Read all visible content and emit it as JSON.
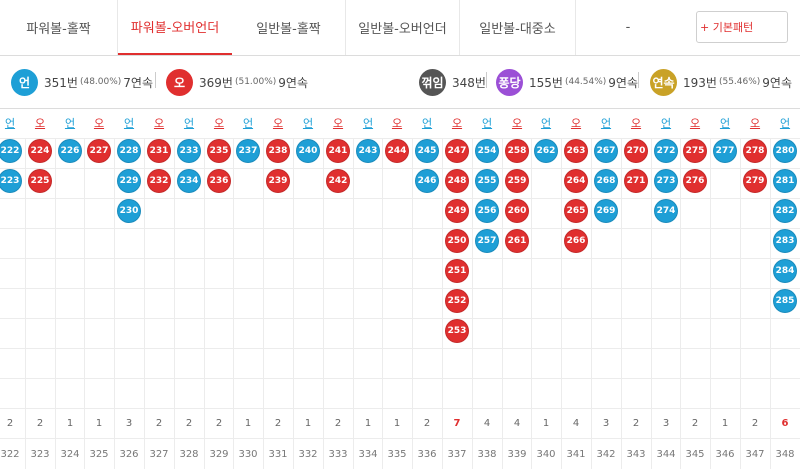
{
  "tabs": [
    {
      "label": "파워볼-홀짝",
      "active": false
    },
    {
      "label": "파워볼-오버언더",
      "active": true
    },
    {
      "label": "일반볼-홀짝",
      "active": false
    },
    {
      "label": "일반볼-오버언더",
      "active": false
    },
    {
      "label": "일반볼-대중소",
      "active": false
    },
    {
      "label": "-",
      "active": false
    }
  ],
  "pattern_button": {
    "label": "+ 기본패턴"
  },
  "stats": {
    "un": {
      "icon": "언",
      "count": "351번",
      "pct": "(48.00%)",
      "streak": "7연속",
      "color": "#1e9fd6"
    },
    "o": {
      "icon": "오",
      "count": "369번",
      "pct": "(51.00%)",
      "streak": "9연속",
      "color": "#e02f2f"
    },
    "kkeokim": {
      "icon": "꺾임",
      "count": "348번",
      "color": "#555555"
    },
    "pongdang": {
      "icon": "퐁당",
      "count": "155번",
      "pct": "(44.54%)",
      "streak": "9연속",
      "color": "#9b4fd6"
    },
    "yeonsok": {
      "icon": "연속",
      "count": "193번",
      "pct": "(55.46%)",
      "streak": "9연속",
      "color": "#c9a227"
    }
  },
  "colors": {
    "un": "#1e9fd6",
    "o": "#e02f2f"
  },
  "columns": [
    {
      "label": "언",
      "type": "un",
      "balls": [
        "222",
        "223"
      ],
      "count": "2",
      "round": "322"
    },
    {
      "label": "오",
      "type": "o",
      "balls": [
        "224",
        "225"
      ],
      "count": "2",
      "round": "323"
    },
    {
      "label": "언",
      "type": "un",
      "balls": [
        "226"
      ],
      "count": "1",
      "round": "324"
    },
    {
      "label": "오",
      "type": "o",
      "balls": [
        "227"
      ],
      "count": "1",
      "round": "325"
    },
    {
      "label": "언",
      "type": "un",
      "balls": [
        "228",
        "229",
        "230"
      ],
      "count": "3",
      "round": "326"
    },
    {
      "label": "오",
      "type": "o",
      "balls": [
        "231",
        "232"
      ],
      "count": "2",
      "round": "327"
    },
    {
      "label": "언",
      "type": "un",
      "balls": [
        "233",
        "234"
      ],
      "count": "2",
      "round": "328"
    },
    {
      "label": "오",
      "type": "o",
      "balls": [
        "235",
        "236"
      ],
      "count": "2",
      "round": "329"
    },
    {
      "label": "언",
      "type": "un",
      "balls": [
        "237"
      ],
      "count": "1",
      "round": "330"
    },
    {
      "label": "오",
      "type": "o",
      "balls": [
        "238",
        "239"
      ],
      "count": "2",
      "round": "331"
    },
    {
      "label": "언",
      "type": "un",
      "balls": [
        "240"
      ],
      "count": "1",
      "round": "332"
    },
    {
      "label": "오",
      "type": "o",
      "balls": [
        "241",
        "242"
      ],
      "count": "2",
      "round": "333"
    },
    {
      "label": "언",
      "type": "un",
      "balls": [
        "243"
      ],
      "count": "1",
      "round": "334"
    },
    {
      "label": "오",
      "type": "o",
      "balls": [
        "244"
      ],
      "count": "1",
      "round": "335"
    },
    {
      "label": "언",
      "type": "un",
      "balls": [
        "245",
        "246"
      ],
      "count": "2",
      "round": "336"
    },
    {
      "label": "오",
      "type": "o",
      "balls": [
        "247",
        "248",
        "249",
        "250",
        "251",
        "252",
        "253"
      ],
      "count": "7",
      "round": "337"
    },
    {
      "label": "언",
      "type": "un",
      "balls": [
        "254",
        "255",
        "256",
        "257"
      ],
      "count": "4",
      "round": "338"
    },
    {
      "label": "오",
      "type": "o",
      "balls": [
        "258",
        "259",
        "260",
        "261"
      ],
      "count": "4",
      "round": "339"
    },
    {
      "label": "언",
      "type": "un",
      "balls": [
        "262"
      ],
      "count": "1",
      "round": "340"
    },
    {
      "label": "오",
      "type": "o",
      "balls": [
        "263",
        "264",
        "265",
        "266"
      ],
      "count": "4",
      "round": "341"
    },
    {
      "label": "언",
      "type": "un",
      "balls": [
        "267",
        "268",
        "269"
      ],
      "count": "3",
      "round": "342"
    },
    {
      "label": "오",
      "type": "o",
      "balls": [
        "270",
        "271"
      ],
      "count": "2",
      "round": "343"
    },
    {
      "label": "언",
      "type": "un",
      "balls": [
        "272",
        "273",
        "274"
      ],
      "count": "3",
      "round": "344"
    },
    {
      "label": "오",
      "type": "o",
      "balls": [
        "275",
        "276"
      ],
      "count": "2",
      "round": "345"
    },
    {
      "label": "언",
      "type": "un",
      "balls": [
        "277"
      ],
      "count": "1",
      "round": "346"
    },
    {
      "label": "오",
      "type": "o",
      "balls": [
        "278",
        "279"
      ],
      "count": "2",
      "round": "347"
    },
    {
      "label": "언",
      "type": "un",
      "balls": [
        "280",
        "281",
        "282",
        "283",
        "284",
        "285"
      ],
      "count": "6",
      "round": "348"
    }
  ]
}
